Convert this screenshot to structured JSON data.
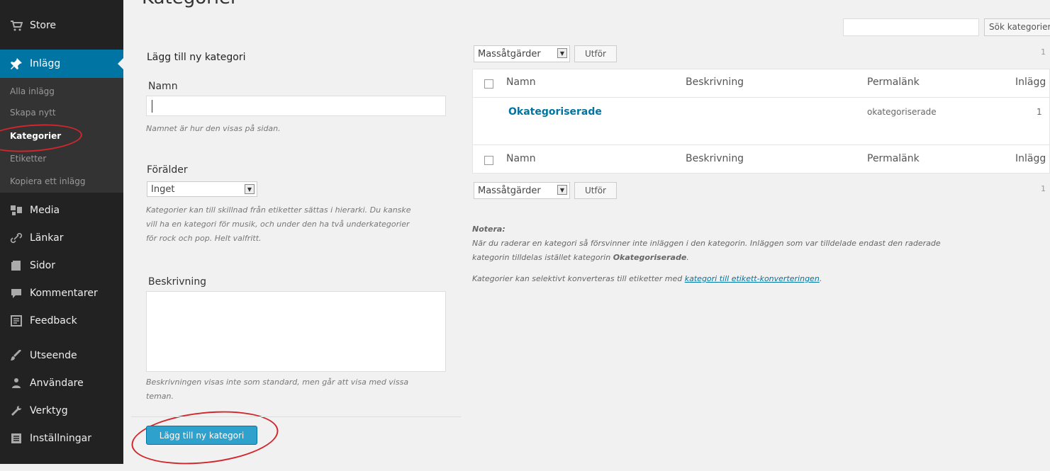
{
  "sidebar": {
    "items": [
      {
        "icon": "store-icon",
        "label": "Store"
      },
      {
        "icon": "pin-icon",
        "label": "Inlägg"
      },
      {
        "icon": "media-icon",
        "label": "Media"
      },
      {
        "icon": "link-icon",
        "label": "Länkar"
      },
      {
        "icon": "pages-icon",
        "label": "Sidor"
      },
      {
        "icon": "comments-icon",
        "label": "Kommentarer"
      },
      {
        "icon": "feedback-icon",
        "label": "Feedback"
      },
      {
        "icon": "appearance-icon",
        "label": "Utseende"
      },
      {
        "icon": "users-icon",
        "label": "Användare"
      },
      {
        "icon": "tools-icon",
        "label": "Verktyg"
      },
      {
        "icon": "settings-icon",
        "label": "Inställningar"
      }
    ],
    "submenu": [
      "Alla inlägg",
      "Skapa nytt",
      "Kategorier",
      "Etiketter",
      "Kopiera ett inlägg"
    ]
  },
  "page": {
    "title": "Kategorier",
    "search_button": "Sök kategorier"
  },
  "form": {
    "heading": "Lägg till ny kategori",
    "name_label": "Namn",
    "name_hint": "Namnet är hur den visas på sidan.",
    "parent_label": "Förälder",
    "parent_value": "Inget",
    "parent_hint_1": "Kategorier kan till skillnad från etiketter sättas i hierarki. Du kanske",
    "parent_hint_2": "vill ha en kategori för musik, och under den ha två underkategorier",
    "parent_hint_3": "för rock och pop. Helt valfritt.",
    "desc_label": "Beskrivning",
    "desc_hint_1": "Beskrivningen visas inte som standard, men går att visa med vissa",
    "desc_hint_2": "teman.",
    "submit": "Lägg till ny kategori"
  },
  "table": {
    "bulk_label": "Massåtgärder",
    "apply": "Utför",
    "columns": [
      "Namn",
      "Beskrivning",
      "Permalänk",
      "Inlägg"
    ],
    "rows": [
      {
        "name": "Okategoriserade",
        "description": "",
        "slug": "okategoriserade",
        "count": "1"
      }
    ],
    "items_top": "1",
    "items_bottom": "1"
  },
  "note": {
    "heading": "Notera:",
    "line1": "När du raderar en kategori så försvinner inte inläggen i den kategorin. Inläggen som var tilldelade endast den raderade",
    "line2_pre": "kategorin tilldelas istället kategorin ",
    "line2_bold": "Okategoriserade",
    "line2_post": ".",
    "line3_pre": "Kategorier kan selektivt konverteras till etiketter med ",
    "line3_link": "kategori till etikett-konverteringen",
    "line3_post": "."
  },
  "colors": {
    "admin_bar": "#222222",
    "active": "#0074a2",
    "annotation": "#d1272c",
    "button": "#2ea2cc"
  }
}
